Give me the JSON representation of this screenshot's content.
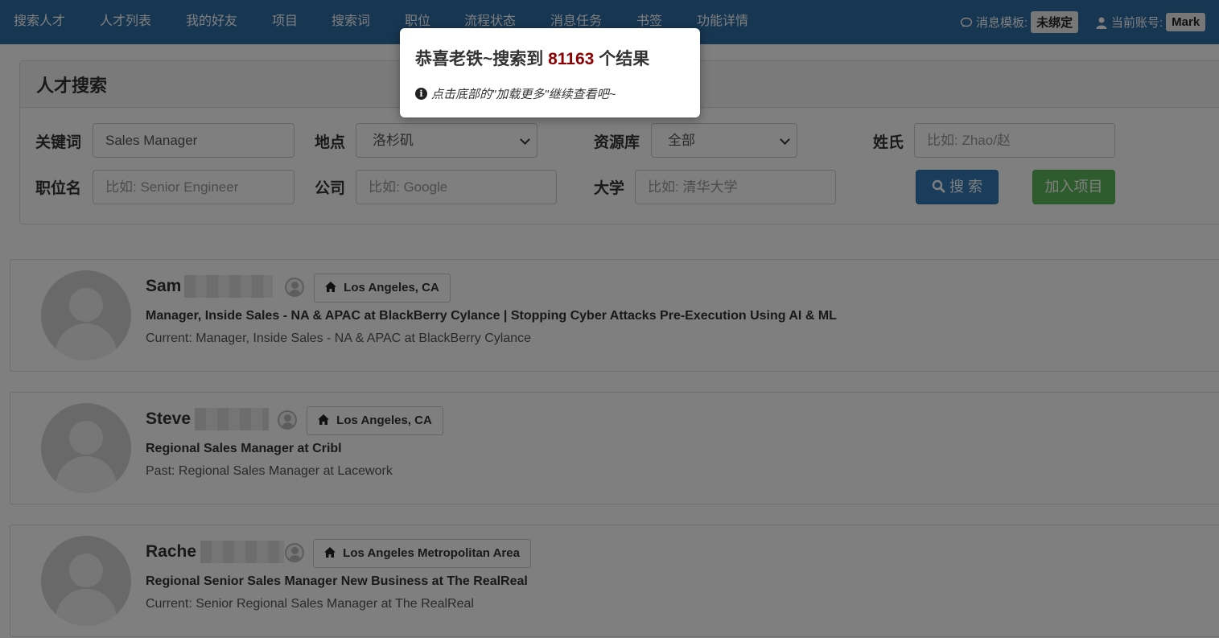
{
  "navbar": {
    "items": [
      "搜索人才",
      "人才列表",
      "我的好友",
      "项目",
      "搜索词",
      "职位",
      "流程状态",
      "消息任务",
      "书签",
      "功能详情"
    ],
    "message_template_label": "消息模板:",
    "message_template_value": "未绑定",
    "account_label": "当前账号:",
    "account_value": "Mark"
  },
  "search_panel": {
    "title": "人才搜索",
    "keyword_label": "关键词",
    "keyword_value": "Sales Manager",
    "location_label": "地点",
    "location_value": "洛杉矶",
    "resource_label": "资源库",
    "resource_value": "全部",
    "surname_label": "姓氏",
    "surname_placeholder": "比如: Zhao/赵",
    "job_title_label": "职位名",
    "job_title_placeholder": "比如: Senior Engineer",
    "company_label": "公司",
    "company_placeholder": "比如: Google",
    "university_label": "大学",
    "university_placeholder": "比如: 清华大学",
    "search_button": "搜 索",
    "add_project_button": "加入项目"
  },
  "results": [
    {
      "name": "Sam",
      "location": "Los Angeles, CA",
      "headline": "Manager, Inside Sales - NA & APAC at BlackBerry Cylance | Stopping Cyber Attacks Pre-Execution Using AI & ML",
      "detail": "Current: Manager, Inside Sales - NA & APAC at BlackBerry Cylance"
    },
    {
      "name": "Steve",
      "location": "Los Angeles, CA",
      "headline": "Regional Sales Manager at Cribl",
      "detail": "Past: Regional Sales Manager at Lacework"
    },
    {
      "name": "Rache",
      "location": "Los Angeles Metropolitan Area",
      "headline": "Regional Senior Sales Manager New Business at The RealReal",
      "detail": "Current: Senior Regional Sales Manager at The RealReal"
    }
  ],
  "modal": {
    "title_prefix": "恭喜老铁~搜索到",
    "count": "81163",
    "title_suffix": "个结果",
    "message": "点击底部的\"加载更多\"继续查看吧~"
  }
}
